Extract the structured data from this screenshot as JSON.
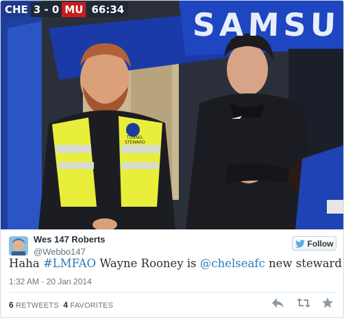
{
  "photo": {
    "scoreboard": {
      "home": "CHE",
      "score": "3 - 0",
      "away": "MU",
      "clock": "66:34"
    },
    "banner_text": "SAMSU",
    "vest_text": "TUNNEL STEWARD"
  },
  "tweet": {
    "author_name": "Wes 147 Roberts",
    "author_handle": "@Webbo147",
    "follow_label": "Follow",
    "text_parts": [
      {
        "text": "Haha ",
        "link": false
      },
      {
        "text": "#LMFAO",
        "link": true
      },
      {
        "text": " Wayne Rooney is ",
        "link": false
      },
      {
        "text": "@chelseafc",
        "link": true
      },
      {
        "text": " new steward lol",
        "link": false
      }
    ],
    "timestamp": "1:32 AM - 20 Jan 2014",
    "retweets_count": "6",
    "retweets_label": "RETWEETS",
    "favorites_count": "4",
    "favorites_label": "FAVORITES"
  },
  "colors": {
    "link": "#2b7bb9",
    "twitter_blue": "#55acee",
    "muted": "#66757f"
  },
  "icons": [
    "twitter-bird-icon",
    "reply-icon",
    "retweet-icon",
    "favorite-star-icon"
  ]
}
